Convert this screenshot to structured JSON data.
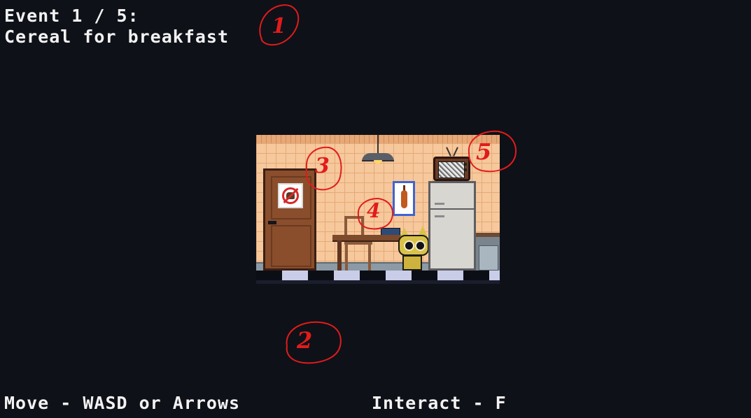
{
  "hud": {
    "event_line": "Event 1 / 5:",
    "event_name": "Cereal for breakfast",
    "move_hint": "Move - WASD or Arrows",
    "interact_hint": "Interact - F"
  },
  "annotations": [
    {
      "id": "1",
      "label": "1"
    },
    {
      "id": "2",
      "label": "2"
    },
    {
      "id": "3",
      "label": "3"
    },
    {
      "id": "4",
      "label": "4"
    },
    {
      "id": "5",
      "label": "5"
    }
  ],
  "colors": {
    "background": "#0e1118",
    "hud_text": "#f2f2f2",
    "annotation": "#e21b1b",
    "wall_tile": "#f6c89c"
  },
  "scene_objects": [
    "door-with-no-pets-sign",
    "ceiling-lamp",
    "violin-painting",
    "table",
    "chair",
    "yellow-cat-player",
    "fridge",
    "tv-with-static",
    "counter"
  ]
}
